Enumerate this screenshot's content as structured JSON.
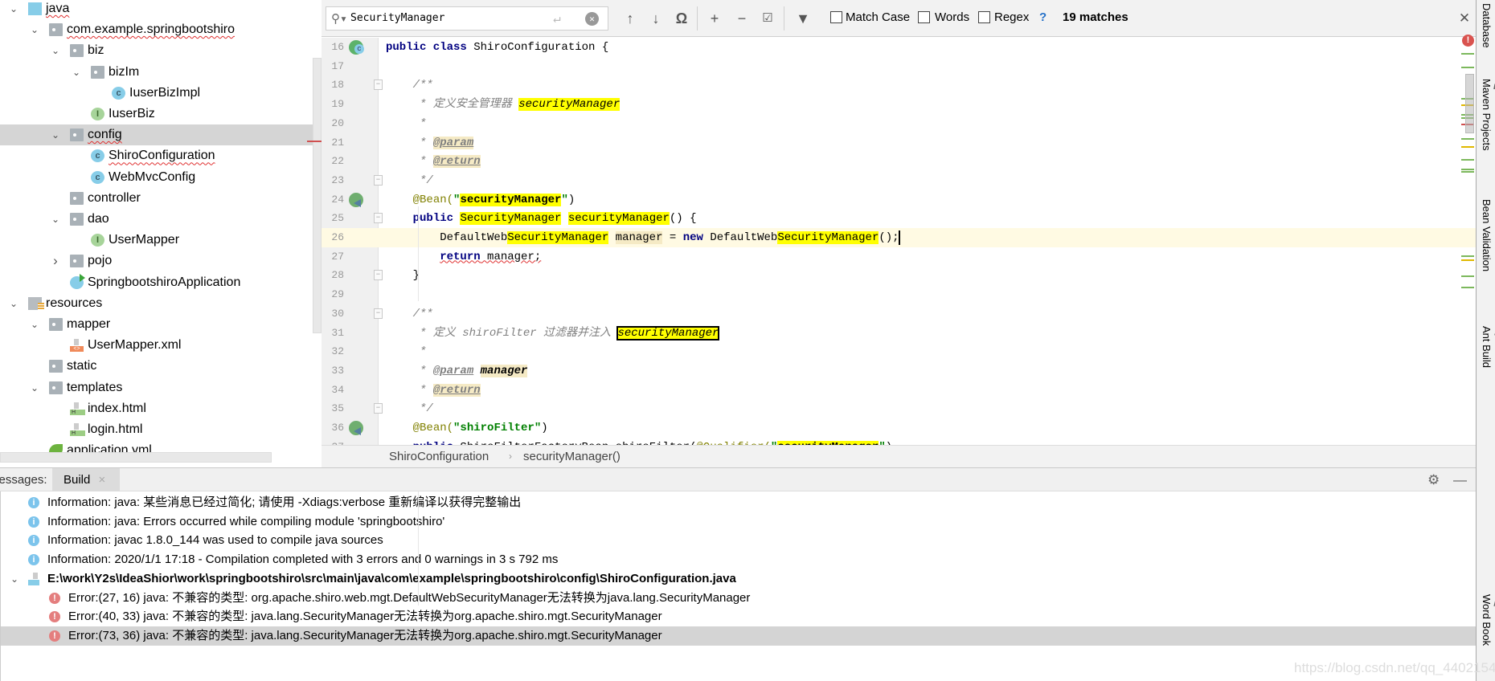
{
  "project_tree": [
    {
      "level": 0,
      "chevron": "down",
      "icon": "source-folder",
      "label": "java",
      "squiggle": true
    },
    {
      "level": 1,
      "chevron": "down",
      "icon": "package",
      "label": "com.example.springbootshiro",
      "squiggle": true
    },
    {
      "level": 2,
      "chevron": "down",
      "icon": "package",
      "label": "biz"
    },
    {
      "level": 3,
      "chevron": "down",
      "icon": "package",
      "label": "bizIm"
    },
    {
      "level": 4,
      "chevron": "",
      "icon": "class",
      "label": "IuserBizImpl"
    },
    {
      "level": 3,
      "chevron": "",
      "icon": "interface",
      "label": "IuserBiz"
    },
    {
      "level": 2,
      "chevron": "down",
      "icon": "package",
      "label": "config",
      "squiggle": true,
      "selected": true
    },
    {
      "level": 3,
      "chevron": "",
      "icon": "class",
      "label": "ShiroConfiguration",
      "squiggle": true
    },
    {
      "level": 3,
      "chevron": "",
      "icon": "class",
      "label": "WebMvcConfig"
    },
    {
      "level": 2,
      "chevron": "",
      "icon": "package",
      "label": "controller"
    },
    {
      "level": 2,
      "chevron": "down",
      "icon": "package",
      "label": "dao"
    },
    {
      "level": 3,
      "chevron": "",
      "icon": "interface",
      "label": "UserMapper"
    },
    {
      "level": 2,
      "chevron": "right",
      "icon": "package",
      "label": "pojo"
    },
    {
      "level": 2,
      "chevron": "",
      "icon": "spring-app",
      "label": "SpringbootshiroApplication"
    },
    {
      "level": 0,
      "chevron": "down",
      "icon": "resources-folder",
      "label": "resources"
    },
    {
      "level": 1,
      "chevron": "down",
      "icon": "package",
      "label": "mapper"
    },
    {
      "level": 2,
      "chevron": "",
      "icon": "xml-file",
      "label": "UserMapper.xml"
    },
    {
      "level": 1,
      "chevron": "",
      "icon": "package",
      "label": "static"
    },
    {
      "level": 1,
      "chevron": "down",
      "icon": "package",
      "label": "templates"
    },
    {
      "level": 2,
      "chevron": "",
      "icon": "html-file",
      "label": "index.html"
    },
    {
      "level": 2,
      "chevron": "",
      "icon": "html-file",
      "label": "login.html"
    },
    {
      "level": 1,
      "chevron": "",
      "icon": "yml-file",
      "label": "application.yml"
    }
  ],
  "search": {
    "value": "SecurityManager",
    "options": [
      "Match Case",
      "Words",
      "Regex"
    ],
    "help": "?",
    "matches": "19 matches"
  },
  "editor": {
    "lines": [
      {
        "n": "16",
        "gutter": "class",
        "s": [
          {
            "t": "public class ",
            "c": "kw"
          },
          {
            "t": "ShiroConfiguration"
          },
          {
            "t": " {"
          }
        ]
      },
      {
        "n": "17",
        "s": []
      },
      {
        "n": "18",
        "fold": true,
        "s": [
          {
            "t": "    "
          },
          {
            "t": "/**",
            "c": "cm"
          }
        ]
      },
      {
        "n": "19",
        "s": [
          {
            "t": "     * 定义安全管理器 ",
            "c": "cm"
          },
          {
            "t": "securityManager",
            "c": "cm match"
          }
        ]
      },
      {
        "n": "20",
        "s": [
          {
            "t": "     *",
            "c": "cm"
          }
        ]
      },
      {
        "n": "21",
        "s": [
          {
            "t": "     * ",
            "c": "cm"
          },
          {
            "t": "@param",
            "c": "cm tag usage"
          }
        ]
      },
      {
        "n": "22",
        "s": [
          {
            "t": "     * ",
            "c": "cm"
          },
          {
            "t": "@return",
            "c": "cm tag usage"
          }
        ]
      },
      {
        "n": "23",
        "fold": true,
        "s": [
          {
            "t": "     */",
            "c": "cm"
          }
        ]
      },
      {
        "n": "24",
        "gutter": "bean",
        "s": [
          {
            "t": "    "
          },
          {
            "t": "@Bean(",
            "c": "ann"
          },
          {
            "t": "\"",
            "c": "str"
          },
          {
            "t": "securityManager",
            "c": "str match"
          },
          {
            "t": "\"",
            "c": "str"
          },
          {
            "t": ")"
          }
        ]
      },
      {
        "n": "25",
        "fold": true,
        "s": [
          {
            "t": "    "
          },
          {
            "t": "public",
            "c": "kw"
          },
          {
            "t": " "
          },
          {
            "t": "SecurityManager",
            "c": "match"
          },
          {
            "t": " "
          },
          {
            "t": "securityManager",
            "c": "match"
          },
          {
            "t": "() {"
          }
        ]
      },
      {
        "n": "26",
        "current": true,
        "s": [
          {
            "t": "        DefaultWeb"
          },
          {
            "t": "SecurityManager",
            "c": "match"
          },
          {
            "t": " "
          },
          {
            "t": "manager",
            "c": "usage"
          },
          {
            "t": " = "
          },
          {
            "t": "new",
            "c": "kw"
          },
          {
            "t": " DefaultWeb"
          },
          {
            "t": "SecurityManager",
            "c": "match"
          },
          {
            "t": "();"
          }
        ]
      },
      {
        "n": "27",
        "s": [
          {
            "t": "        "
          },
          {
            "t": "return",
            "c": "kw err"
          },
          {
            "t": " manager;",
            "c": "err"
          }
        ]
      },
      {
        "n": "28",
        "fold": true,
        "s": [
          {
            "t": "    }"
          }
        ]
      },
      {
        "n": "29",
        "s": []
      },
      {
        "n": "30",
        "fold": true,
        "s": [
          {
            "t": "    "
          },
          {
            "t": "/**",
            "c": "cm"
          }
        ]
      },
      {
        "n": "31",
        "s": [
          {
            "t": "     * 定义 shiroFilter 过滤器并注入 ",
            "c": "cm"
          },
          {
            "t": "securityManager",
            "c": "cm matchsel"
          }
        ]
      },
      {
        "n": "32",
        "s": [
          {
            "t": "     *",
            "c": "cm"
          }
        ]
      },
      {
        "n": "33",
        "s": [
          {
            "t": "     * ",
            "c": "cm"
          },
          {
            "t": "@param",
            "c": "cm tag"
          },
          {
            "t": " ",
            "c": "cm"
          },
          {
            "t": "manager",
            "c": "cm bolditalic usage"
          }
        ]
      },
      {
        "n": "34",
        "s": [
          {
            "t": "     * ",
            "c": "cm"
          },
          {
            "t": "@return",
            "c": "cm tag usage"
          }
        ]
      },
      {
        "n": "35",
        "fold": true,
        "s": [
          {
            "t": "     */",
            "c": "cm"
          }
        ]
      },
      {
        "n": "36",
        "gutter": "bean",
        "s": [
          {
            "t": "    "
          },
          {
            "t": "@Bean(",
            "c": "ann"
          },
          {
            "t": "\"shiroFilter\"",
            "c": "str"
          },
          {
            "t": ")"
          }
        ]
      },
      {
        "n": "37",
        "s": [
          {
            "t": "    "
          },
          {
            "t": "public",
            "c": "kw"
          },
          {
            "t": " ShiroFilterFactoryBean shiroFilter("
          },
          {
            "t": "@Qualifier(",
            "c": "ann"
          },
          {
            "t": "\"",
            "c": "str"
          },
          {
            "t": "securityManager",
            "c": "str match"
          },
          {
            "t": "\"",
            "c": "str"
          },
          {
            "t": ")"
          }
        ]
      }
    ]
  },
  "breadcrumb": [
    "ShiroConfiguration",
    "securityManager()"
  ],
  "bottom_panel": {
    "label": "Messages:",
    "tab": "Build",
    "rows": [
      {
        "type": "info",
        "text": "Information: java: 某些消息已经过简化; 请使用 -Xdiags:verbose 重新编译以获得完整输出"
      },
      {
        "type": "info",
        "text": "Information: java: Errors occurred while compiling module 'springbootshiro'"
      },
      {
        "type": "info",
        "text": "Information: javac 1.8.0_144 was used to compile java sources"
      },
      {
        "type": "info",
        "text": "Information: 2020/1/1 17:18 - Compilation completed with 3 errors and 0 warnings in 3 s 792 ms"
      },
      {
        "type": "file",
        "text": "E:\\work\\Y2s\\IdeaShior\\work\\springbootshiro\\src\\main\\java\\com\\example\\springbootshiro\\config\\ShiroConfiguration.java"
      },
      {
        "type": "error",
        "text": "Error:(27, 16)  java: 不兼容的类型: org.apache.shiro.web.mgt.DefaultWebSecurityManager无法转换为java.lang.SecurityManager"
      },
      {
        "type": "error",
        "text": "Error:(40, 33)  java: 不兼容的类型: java.lang.SecurityManager无法转换为org.apache.shiro.mgt.SecurityManager"
      },
      {
        "type": "error",
        "text": "Error:(73, 36)  java: 不兼容的类型: java.lang.SecurityManager无法转换为org.apache.shiro.mgt.SecurityManager",
        "selected": true
      }
    ]
  },
  "right_tool_windows": [
    "Database",
    "Maven Projects",
    "Bean Validation",
    "Ant Build",
    "Word Book"
  ],
  "watermark": "https://blog.csdn.net/qq_4402154",
  "colors": {
    "search_match": "#ffff00",
    "usage_highlight": "#f5eac5",
    "current_line": "#fffae3",
    "error": "#e47e7e",
    "info": "#7cc4ec"
  }
}
